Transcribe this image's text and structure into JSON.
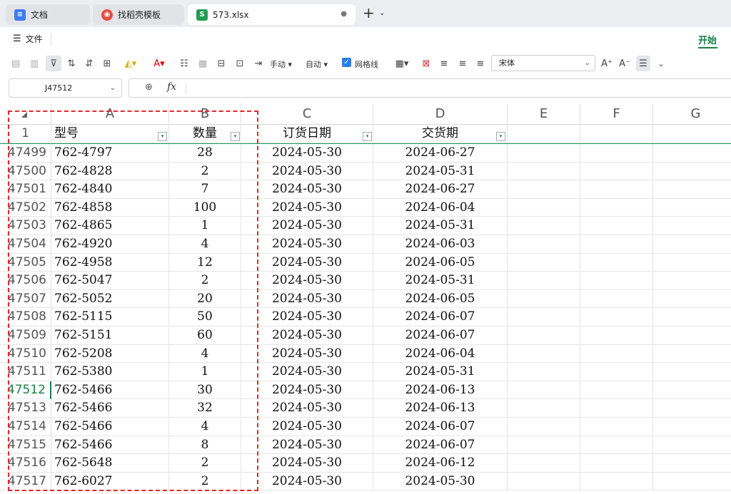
{
  "tabs": [
    {
      "label": "文档",
      "icon": "docs-icon",
      "color": "#3b7cf0",
      "glyph": "≡",
      "active": false
    },
    {
      "label": "找稻壳模板",
      "icon": "docer-icon",
      "color": "#e84a3c",
      "glyph": "◉",
      "active": false
    },
    {
      "label": "573.xlsx",
      "icon": "spreadsheet-icon",
      "color": "#1f9d55",
      "glyph": "S",
      "active": true
    }
  ],
  "tab_close": "●",
  "new_tab": "+",
  "menu": {
    "file_label": "文件",
    "start_label": "开始"
  },
  "toolbar": {
    "manual_label": "手动",
    "auto_label": "自动",
    "gridlines_label": "网格线",
    "font_name": "宋体"
  },
  "formula_bar": {
    "cell_ref": "J47512",
    "fx_label": "fx",
    "value": ""
  },
  "columns": [
    "A",
    "B",
    "C",
    "D",
    "E",
    "F",
    "G"
  ],
  "header_row": {
    "row": "1",
    "cells": [
      "型号",
      "数量",
      "订货日期",
      "交货期"
    ]
  },
  "rows": [
    {
      "row": "47499",
      "a": "762-4797",
      "b": "28",
      "c": "2024-05-30",
      "d": "2024-06-27"
    },
    {
      "row": "47500",
      "a": "762-4828",
      "b": "2",
      "c": "2024-05-30",
      "d": "2024-05-31"
    },
    {
      "row": "47501",
      "a": "762-4840",
      "b": "7",
      "c": "2024-05-30",
      "d": "2024-06-27"
    },
    {
      "row": "47502",
      "a": "762-4858",
      "b": "100",
      "c": "2024-05-30",
      "d": "2024-06-04"
    },
    {
      "row": "47503",
      "a": "762-4865",
      "b": "1",
      "c": "2024-05-30",
      "d": "2024-05-31"
    },
    {
      "row": "47504",
      "a": "762-4920",
      "b": "4",
      "c": "2024-05-30",
      "d": "2024-06-03"
    },
    {
      "row": "47505",
      "a": "762-4958",
      "b": "12",
      "c": "2024-05-30",
      "d": "2024-06-05"
    },
    {
      "row": "47506",
      "a": "762-5047",
      "b": "2",
      "c": "2024-05-30",
      "d": "2024-05-31"
    },
    {
      "row": "47507",
      "a": "762-5052",
      "b": "20",
      "c": "2024-05-30",
      "d": "2024-06-05"
    },
    {
      "row": "47508",
      "a": "762-5115",
      "b": "50",
      "c": "2024-05-30",
      "d": "2024-06-07"
    },
    {
      "row": "47509",
      "a": "762-5151",
      "b": "60",
      "c": "2024-05-30",
      "d": "2024-06-07"
    },
    {
      "row": "47510",
      "a": "762-5208",
      "b": "4",
      "c": "2024-05-30",
      "d": "2024-06-04"
    },
    {
      "row": "47511",
      "a": "762-5380",
      "b": "1",
      "c": "2024-05-30",
      "d": "2024-05-31"
    },
    {
      "row": "47512",
      "a": "762-5466",
      "b": "30",
      "c": "2024-05-30",
      "d": "2024-06-13",
      "selected": true
    },
    {
      "row": "47513",
      "a": "762-5466",
      "b": "32",
      "c": "2024-05-30",
      "d": "2024-06-13"
    },
    {
      "row": "47514",
      "a": "762-5466",
      "b": "4",
      "c": "2024-05-30",
      "d": "2024-06-07"
    },
    {
      "row": "47515",
      "a": "762-5466",
      "b": "8",
      "c": "2024-05-30",
      "d": "2024-06-07"
    },
    {
      "row": "47516",
      "a": "762-5648",
      "b": "2",
      "c": "2024-05-30",
      "d": "2024-06-12"
    },
    {
      "row": "47517",
      "a": "762-6027",
      "b": "2",
      "c": "2024-05-30",
      "d": "2024-05-30"
    }
  ],
  "colors": {
    "accent": "#1a7f45",
    "highlight": "#e8252a",
    "checkbox": "#2b7de9"
  }
}
